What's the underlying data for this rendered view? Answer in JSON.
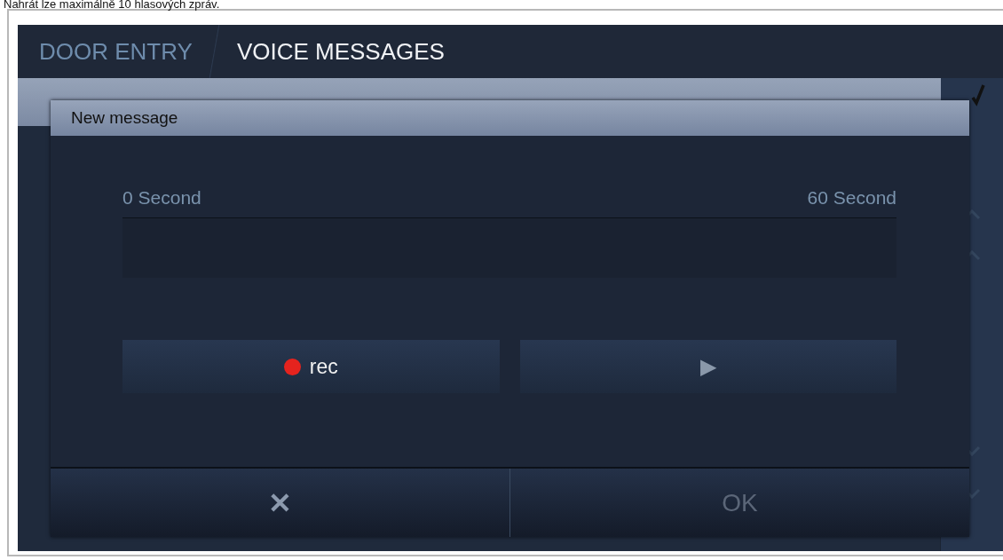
{
  "caption": "Nahrát lze maximálně 10 hlasových zpráv.",
  "breadcrumbs": [
    {
      "label": "DOOR ENTRY",
      "selected": false
    },
    {
      "label": "VOICE MESSAGES",
      "selected": true
    }
  ],
  "dialog": {
    "title": "New message",
    "progress": {
      "start_label": "0 Second",
      "end_label": "60 Second",
      "level": 0
    },
    "rec_button": {
      "label": "rec"
    },
    "play_button": {
      "label": "▶"
    },
    "footer": [
      {
        "kind": "cancel",
        "label": "✕",
        "disabled": false
      },
      {
        "kind": "ok",
        "label": "OK",
        "disabled": true
      }
    ]
  }
}
